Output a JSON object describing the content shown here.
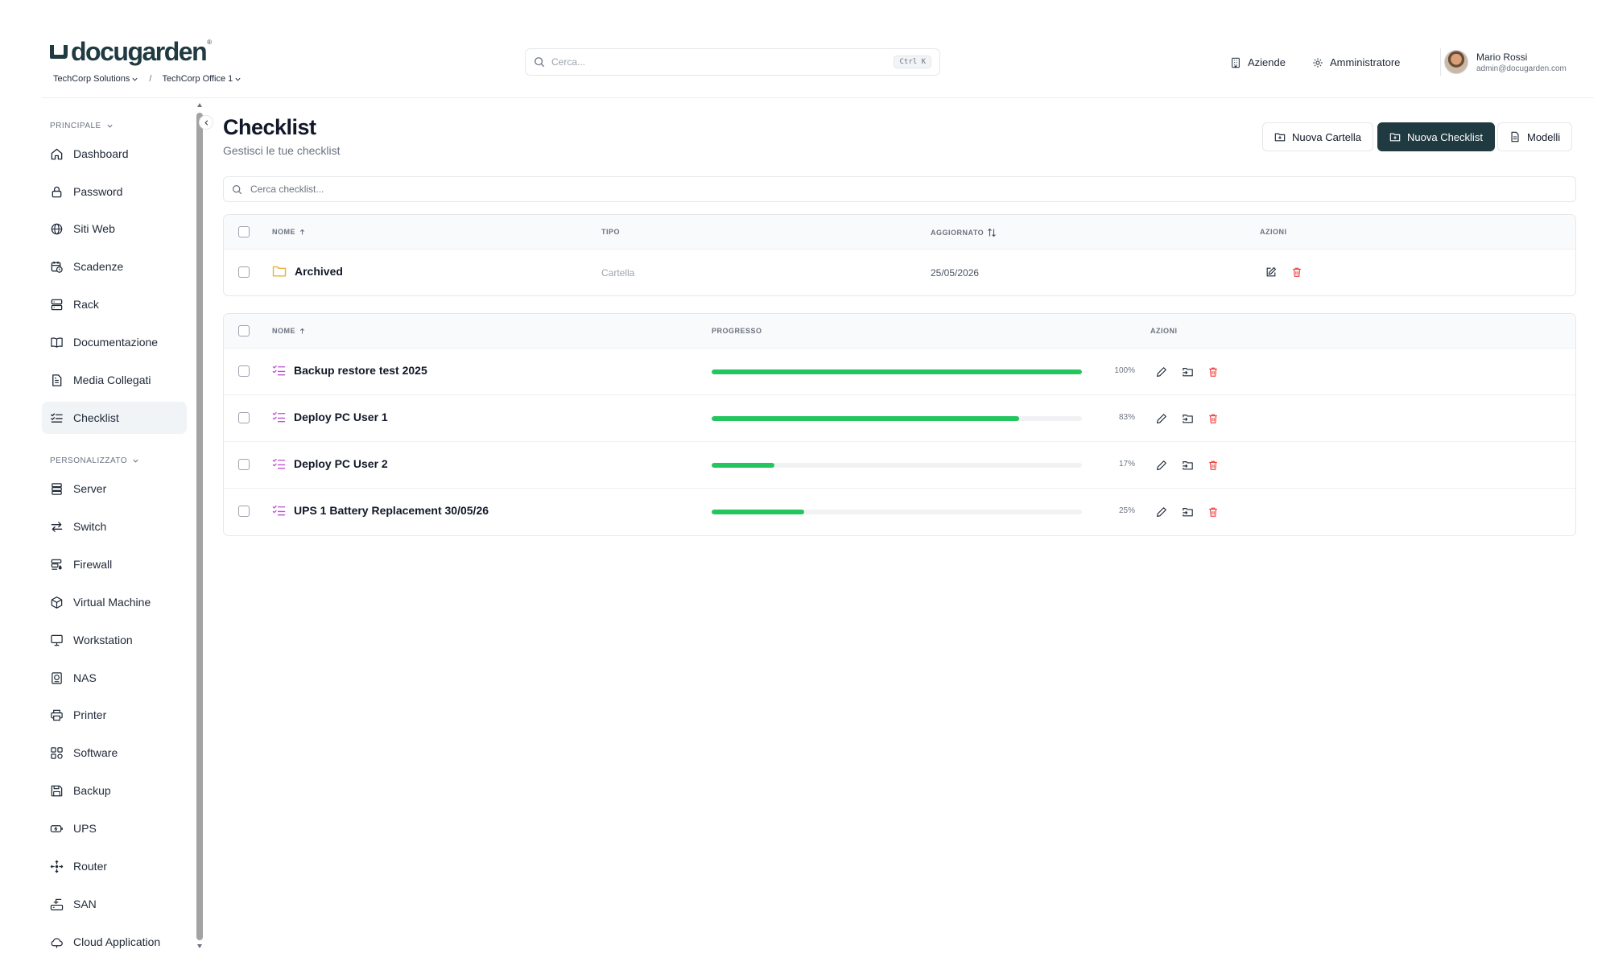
{
  "header": {
    "logo_text": "docugarden",
    "logo_reg": "®",
    "breadcrumb": [
      "TechCorp Solutions",
      "TechCorp Office 1"
    ],
    "breadcrumb_sep": "/",
    "search": {
      "placeholder": "Cerca...",
      "shortcut": "Ctrl K"
    },
    "links": {
      "companies": "Aziende",
      "admin": "Amministratore"
    },
    "user": {
      "name": "Mario Rossi",
      "email": "admin@docugarden.com"
    }
  },
  "sidebar": {
    "sections": [
      {
        "title": "PRINCIPALE",
        "items": [
          {
            "label": "Dashboard",
            "icon": "home-icon"
          },
          {
            "label": "Password",
            "icon": "lock-icon"
          },
          {
            "label": "Siti Web",
            "icon": "globe-icon"
          },
          {
            "label": "Scadenze",
            "icon": "calendar-clock-icon"
          },
          {
            "label": "Rack",
            "icon": "server-rack-icon"
          },
          {
            "label": "Documentazione",
            "icon": "book-open-icon"
          },
          {
            "label": "Media Collegati",
            "icon": "file-text-icon"
          },
          {
            "label": "Checklist",
            "icon": "list-checks-icon",
            "active": true
          }
        ]
      },
      {
        "title": "PERSONALIZZATO",
        "items": [
          {
            "label": "Server",
            "icon": "server-icon"
          },
          {
            "label": "Switch",
            "icon": "arrows-switch-icon"
          },
          {
            "label": "Firewall",
            "icon": "firewall-icon"
          },
          {
            "label": "Virtual Machine",
            "icon": "cube-icon"
          },
          {
            "label": "Workstation",
            "icon": "monitor-icon"
          },
          {
            "label": "NAS",
            "icon": "nas-icon"
          },
          {
            "label": "Printer",
            "icon": "printer-icon"
          },
          {
            "label": "Software",
            "icon": "component-icon"
          },
          {
            "label": "Backup",
            "icon": "save-icon"
          },
          {
            "label": "UPS",
            "icon": "battery-icon"
          },
          {
            "label": "Router",
            "icon": "router-icon"
          },
          {
            "label": "SAN",
            "icon": "storage-icon"
          },
          {
            "label": "Cloud Application",
            "icon": "cloud-icon"
          }
        ]
      }
    ]
  },
  "main": {
    "title": "Checklist",
    "subtitle": "Gestisci le tue checklist",
    "buttons": {
      "new_folder": "Nuova Cartella",
      "new_checklist": "Nuova Checklist",
      "templates": "Modelli"
    },
    "search_placeholder": "Cerca checklist...",
    "folders_table": {
      "columns": [
        "NOME",
        "TIPO",
        "AGGIORNATO",
        "AZIONI"
      ],
      "rows": [
        {
          "name": "Archived",
          "type": "Cartella",
          "updated": "25/05/2026"
        }
      ]
    },
    "checklists_table": {
      "columns": [
        "NOME",
        "PROGRESSO",
        "AZIONI"
      ],
      "rows": [
        {
          "name": "Backup restore test 2025",
          "progress": 100,
          "progress_label": "100%"
        },
        {
          "name": "Deploy PC User 1",
          "progress": 83,
          "progress_label": "83%"
        },
        {
          "name": "Deploy PC User 2",
          "progress": 17,
          "progress_label": "17%"
        },
        {
          "name": "UPS 1 Battery Replacement 30/05/26",
          "progress": 25,
          "progress_label": "25%"
        }
      ]
    }
  },
  "colors": {
    "brand": "#1f3a40",
    "progress": "#22c55e",
    "danger": "#ef4444",
    "folder": "#e8b23a",
    "checklist_icon": "#c04fd6"
  }
}
